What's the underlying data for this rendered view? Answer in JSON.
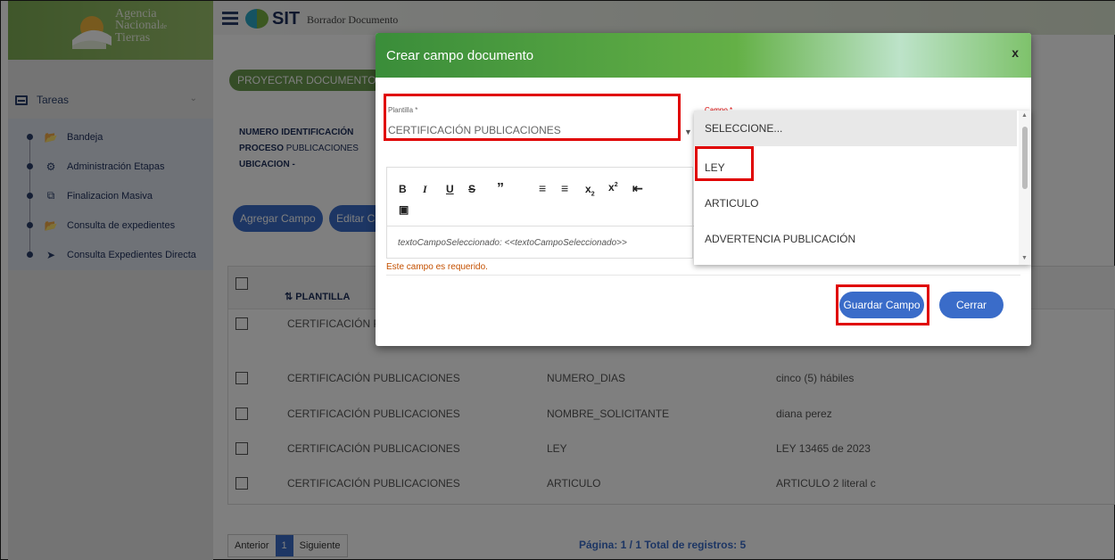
{
  "brand": {
    "name_lines": [
      "Agencia",
      "Nacional",
      "Tierras"
    ],
    "name_suffix": "de",
    "sit_logo": "SIT"
  },
  "header": {
    "title": "Borrador Documento"
  },
  "sidebar": {
    "tasks_label": "Tareas",
    "items": [
      {
        "label": "Bandeja",
        "icon": "folder-open-icon"
      },
      {
        "label": "Administración Etapas",
        "icon": "gear-icon"
      },
      {
        "label": "Finalizacion Masiva",
        "icon": "copy-icon"
      },
      {
        "label": "Consulta de expedientes",
        "icon": "folder-open-icon"
      },
      {
        "label": "Consulta Expedientes Directa",
        "icon": "plane-icon"
      }
    ]
  },
  "main": {
    "project_button": "PROYECTAR DOCUMENTO",
    "info": {
      "numero_label": "NUMERO IDENTIFICACIÓN",
      "proceso_label": "PROCESO",
      "proceso_value": "PUBLICACIONES",
      "ubicacion_label": "UBICACION -"
    },
    "buttons": {
      "add_field": "Agregar Campo",
      "edit_field": "Editar Ca"
    },
    "table": {
      "header": "PLANTILLA",
      "partial_first_row": "CERTIFICACIÓN PU",
      "rows": [
        {
          "plantilla": "CERTIFICACIÓN PUBLICACIONES",
          "campo": "NUMERO_DIAS",
          "valor": "cinco (5) hábiles"
        },
        {
          "plantilla": "CERTIFICACIÓN PUBLICACIONES",
          "campo": "NOMBRE_SOLICITANTE",
          "valor": "diana perez"
        },
        {
          "plantilla": "CERTIFICACIÓN PUBLICACIONES",
          "campo": "LEY",
          "valor": "LEY 13465 de 2023"
        },
        {
          "plantilla": "CERTIFICACIÓN PUBLICACIONES",
          "campo": "ARTICULO",
          "valor": "ARTICULO 2 literal c"
        }
      ]
    },
    "pagination": {
      "prev": "Anterior",
      "current": "1",
      "next": "Siguiente",
      "info": "Página: 1 / 1 Total de registros: 5"
    }
  },
  "modal": {
    "title": "Crear campo documento",
    "close": "x",
    "plantilla_label": "Plantilla *",
    "plantilla_value": "CERTIFICACIÓN PUBLICACIONES",
    "campo_label": "Campo *",
    "editor_content": "textoCampoSeleccionado: <<textoCampoSeleccionado>>",
    "error": "Este campo es requerido.",
    "save_button": "Guardar Campo",
    "close_button": "Cerrar",
    "campo_options": [
      "SELECCIONE...",
      "LEY",
      "ARTICULO",
      "ADVERTENCIA PUBLICACIÓN"
    ],
    "highlight_color": "#e00000"
  }
}
